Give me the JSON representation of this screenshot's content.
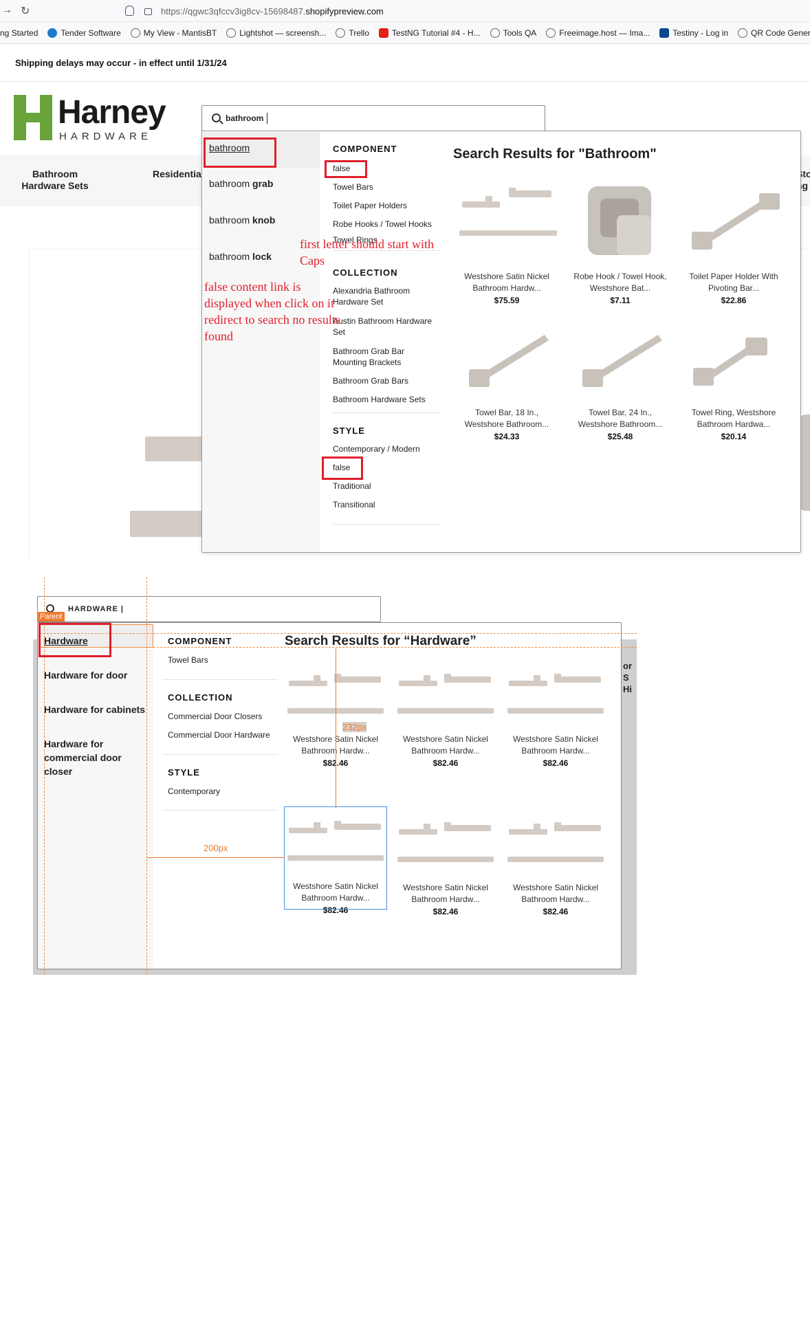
{
  "browser": {
    "url_prefix": "https://qgwc3qfccv3ig8cv-15698487.",
    "url_domain": "shopifypreview.com",
    "bookmarks": [
      {
        "label": "ng Started",
        "icon": "none"
      },
      {
        "label": "Tender Software",
        "icon": "globe-blue-icon"
      },
      {
        "label": "My View - MantisBT",
        "icon": "globe-icon"
      },
      {
        "label": "Lightshot — screensh...",
        "icon": "globe-icon"
      },
      {
        "label": "Trello",
        "icon": "globe-icon"
      },
      {
        "label": "TestNG Tutorial #4 - H...",
        "icon": "youtube-icon"
      },
      {
        "label": "Tools QA",
        "icon": "gear-icon"
      },
      {
        "label": "Freeimage.host — Ima...",
        "icon": "globe-icon"
      },
      {
        "label": "Testiny - Log in",
        "icon": "testiny-icon"
      },
      {
        "label": "QR Code Generator",
        "icon": "globe-icon"
      }
    ]
  },
  "site": {
    "announcement": "Shipping delays may occur - in effect until 1/31/24",
    "logo_main": "Harney",
    "logo_sub": "HARDWARE",
    "nav": [
      "Bathroom Hardware Sets",
      "Residential Door Locks",
      "Sto ng"
    ]
  },
  "search1": {
    "query": "bathroom",
    "suggestions": [
      {
        "prefix": "bathroom",
        "suffix": ""
      },
      {
        "prefix": "bathroom",
        "suffix": "grab"
      },
      {
        "prefix": "bathroom",
        "suffix": "knob"
      },
      {
        "prefix": "bathroom",
        "suffix": "lock"
      }
    ],
    "component_heading": "COMPONENT",
    "component_items": [
      "false",
      "Towel Bars",
      "Toilet Paper Holders",
      "Robe Hooks / Towel Hooks",
      "Towel Rings"
    ],
    "collection_heading": "COLLECTION",
    "collection_items": [
      "Alexandria Bathroom Hardware Set",
      "Austin Bathroom Hardware Set",
      "Bathroom Grab Bar Mounting Brackets",
      "Bathroom Grab Bars",
      "Bathroom Hardware Sets"
    ],
    "style_heading": "STYLE",
    "style_items": [
      "Contemporary / Modern",
      "false",
      "Traditional",
      "Transitional"
    ],
    "results_heading": "Search Results for \"Bathroom\"",
    "products": [
      {
        "title": "Westshore Satin Nickel Bathroom Hardw...",
        "price": "$75.59",
        "image": "bath-set"
      },
      {
        "title": "Robe Hook / Towel Hook, Westshore Bat...",
        "price": "$7.11",
        "image": "robe-hook"
      },
      {
        "title": "Toilet Paper Holder With Pivoting Bar...",
        "price": "$22.86",
        "image": "tp-holder"
      },
      {
        "title": "Towel Bar, 18 In., Westshore Bathroom...",
        "price": "$24.33",
        "image": "towel-bar"
      },
      {
        "title": "Towel Bar, 24 In., Westshore Bathroom...",
        "price": "$25.48",
        "image": "towel-bar"
      },
      {
        "title": "Towel Ring, Westshore Bathroom Hardwa...",
        "price": "$20.14",
        "image": "towel-ring"
      }
    ]
  },
  "annotations": {
    "caps_note": "first letter should start with Caps",
    "false_note": "false content link is displayed when click on it redirect to search no results found"
  },
  "search2": {
    "query": "HARDWARE |",
    "parent_badge": "Parent",
    "suggestions": [
      "Hardware",
      "Hardware for door",
      "Hardware for cabinets",
      "Hardware for commercial door closer"
    ],
    "component_heading": "COMPONENT",
    "component_items": [
      "Towel Bars"
    ],
    "collection_heading": "COLLECTION",
    "collection_items": [
      "Commercial Door Closers",
      "Commercial Door Hardware"
    ],
    "style_heading": "STYLE",
    "style_items": [
      "Contemporary"
    ],
    "results_heading": "Search Results for “Hardware”",
    "products": [
      {
        "title": "Westshore Satin Nickel Bathroom Hardw...",
        "price": "$82.46"
      },
      {
        "title": "Westshore Satin Nickel Bathroom Hardw...",
        "price": "$82.46"
      },
      {
        "title": "Westshore Satin Nickel Bathroom Hardw...",
        "price": "$82.46"
      },
      {
        "title": "Westshore Satin Nickel Bathroom Hardw...",
        "price": "$82.46"
      },
      {
        "title": "Westshore Satin Nickel Bathroom Hardw...",
        "price": "$82.46"
      },
      {
        "title": "Westshore Satin Nickel Bathroom Hardw...",
        "price": "$82.46"
      }
    ],
    "measure_vertical": "232px",
    "measure_horizontal": "200px",
    "nav_peek": "or S Hi"
  },
  "colors": {
    "brand_green": "#6aa33a",
    "annotation_red": "#e01e2b",
    "guide_orange": "#f07a2c",
    "product_metal": "#d3cbc4"
  }
}
